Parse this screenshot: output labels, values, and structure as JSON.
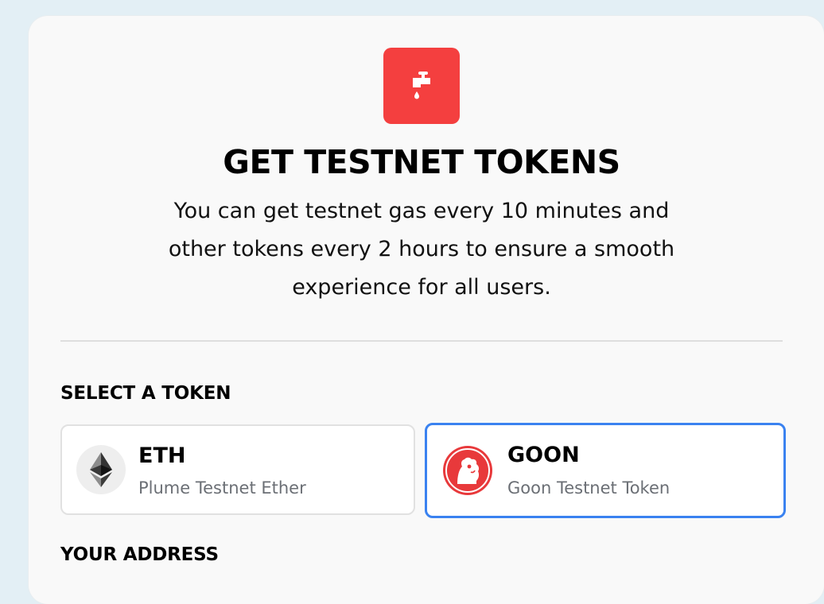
{
  "faucet": {
    "icon": "faucet-icon",
    "badge_color": "#f43f3f"
  },
  "title": "GET TESTNET TOKENS",
  "description": "You can get testnet gas every 10 minutes and other tokens every 2 hours to ensure a smooth experience for all users.",
  "select_token": {
    "label": "SELECT A TOKEN",
    "selected": "GOON",
    "tokens": [
      {
        "symbol": "ETH",
        "name": "Plume Testnet Ether",
        "icon": "ethereum-icon"
      },
      {
        "symbol": "GOON",
        "name": "Goon Testnet Token",
        "icon": "goon-icon"
      }
    ]
  },
  "address": {
    "label": "YOUR ADDRESS"
  },
  "colors": {
    "accent": "#3a82f0",
    "badge": "#f43f3f",
    "background": "#e3eff5",
    "card": "#f9f9f9"
  }
}
